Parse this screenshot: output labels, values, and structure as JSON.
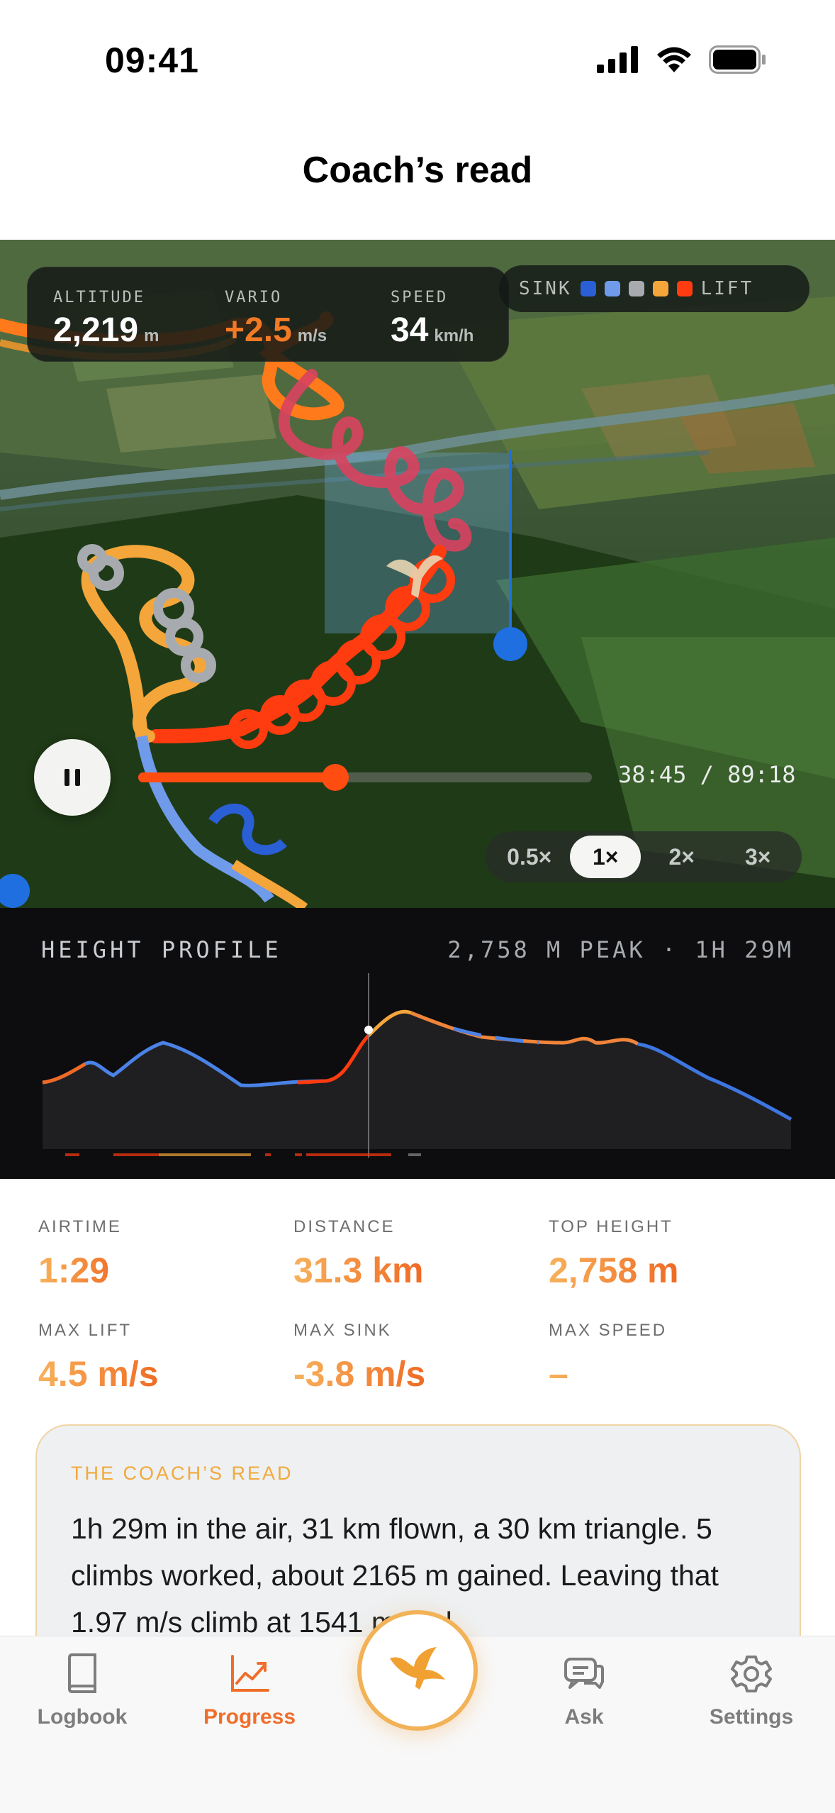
{
  "status_bar": {
    "time": "09:41"
  },
  "header": {
    "title": "Coach’s read"
  },
  "hud": {
    "altitude": {
      "label": "ALTITUDE",
      "value": "2,219",
      "unit": "m"
    },
    "vario": {
      "label": "VARIO",
      "value": "+2.5",
      "unit": "m/s"
    },
    "speed": {
      "label": "SPEED",
      "value": "34",
      "unit": "km/h"
    }
  },
  "legend": {
    "left_label": "SINK",
    "right_label": "LIFT",
    "colors": [
      "#2a5fd6",
      "#6f9bea",
      "#a7abb0",
      "#f4a63a",
      "#ff3b10"
    ]
  },
  "playback": {
    "state": "playing",
    "progress_fraction": 0.435,
    "time_text": "38:45 / 89:18",
    "speeds": [
      "0.5×",
      "1×",
      "2×",
      "3×"
    ],
    "active_speed": "1×"
  },
  "profile": {
    "title": "HEIGHT PROFILE",
    "meta": "2,758 M PEAK · 1H 29M"
  },
  "stats": [
    {
      "label": "AIRTIME",
      "value": "1:29"
    },
    {
      "label": "DISTANCE",
      "value": "31.3 km"
    },
    {
      "label": "TOP HEIGHT",
      "value": "2,758 m"
    },
    {
      "label": "MAX LIFT",
      "value": "4.5 m/s"
    },
    {
      "label": "MAX SINK",
      "value": "-3.8 m/s"
    },
    {
      "label": "MAX SPEED",
      "value": "–"
    }
  ],
  "coach": {
    "label": "THE COACH’S READ",
    "text": "1h 29m in the air, 31 km flown, a 30 km triangle. 5 climbs worked, about 2165 m gained. Leaving that 1.97 m/s climb at 1541 m and"
  },
  "tabs": [
    {
      "label": "Logbook",
      "icon": "book-icon"
    },
    {
      "label": "Progress",
      "icon": "chart-icon",
      "active": true
    },
    {
      "label": "",
      "icon": "eagle-icon"
    },
    {
      "label": "Ask",
      "icon": "chat-icon"
    },
    {
      "label": "Settings",
      "icon": "gear-icon"
    }
  ]
}
